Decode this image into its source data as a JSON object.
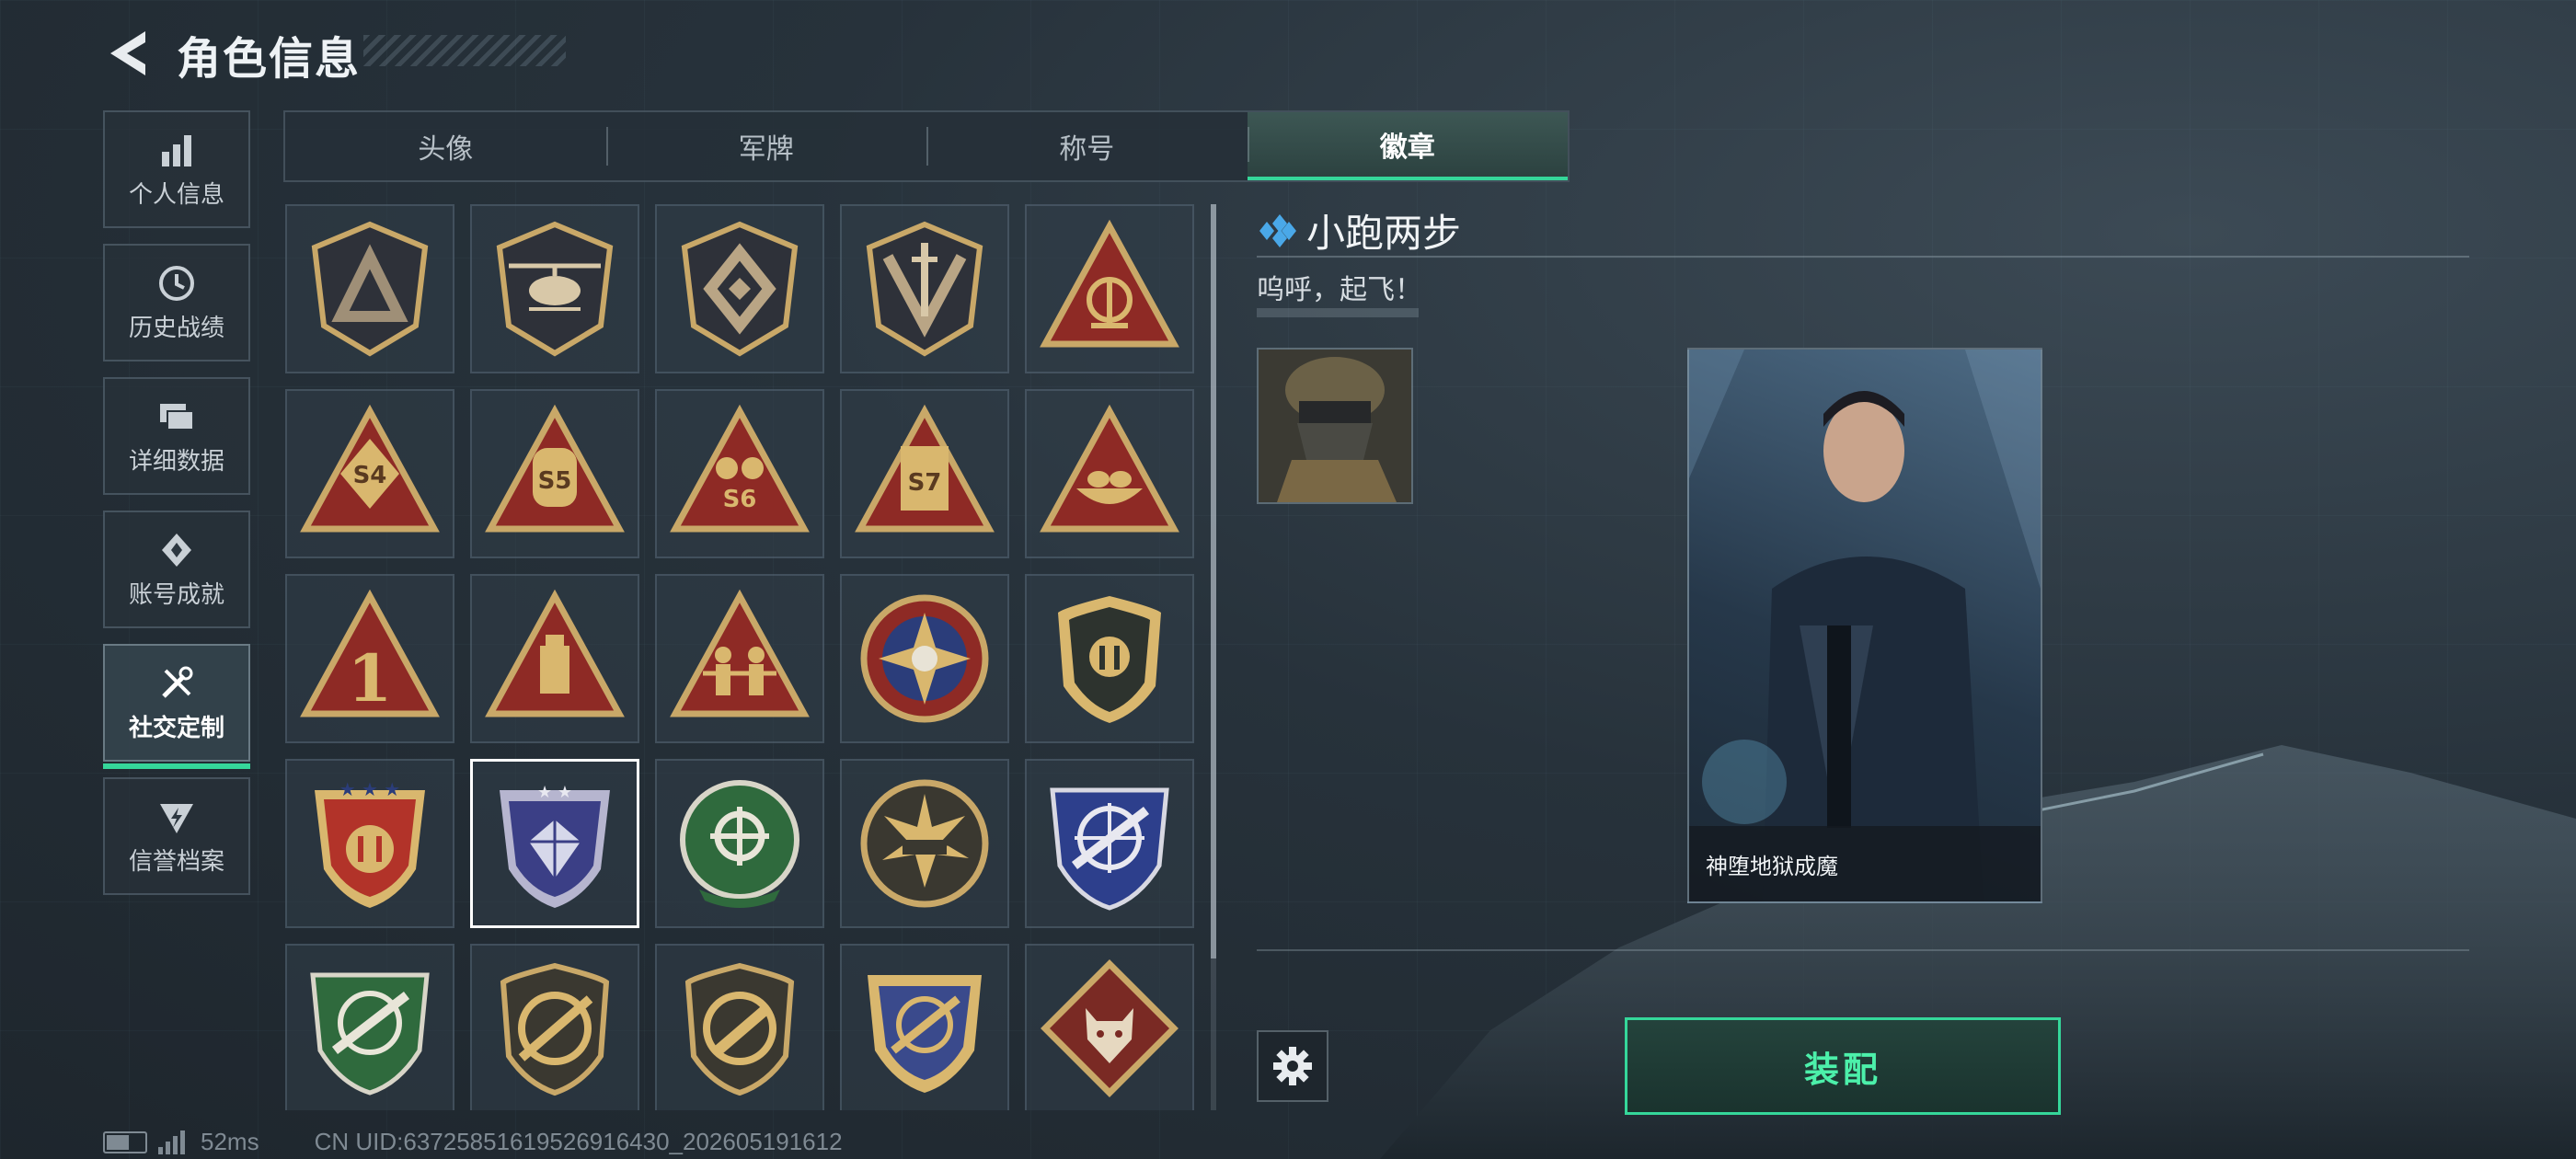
{
  "header": {
    "title": "角色信息"
  },
  "sidebar": {
    "items": [
      {
        "label": "个人信息",
        "icon": "bar-chart-icon",
        "active": false
      },
      {
        "label": "历史战绩",
        "icon": "clock-history-icon",
        "active": false
      },
      {
        "label": "详细数据",
        "icon": "folders-icon",
        "active": false
      },
      {
        "label": "账号成就",
        "icon": "achievement-icon",
        "active": false
      },
      {
        "label": "社交定制",
        "icon": "tools-icon",
        "active": true
      },
      {
        "label": "信誉档案",
        "icon": "reputation-shield-icon",
        "active": false
      }
    ]
  },
  "tabs": [
    {
      "label": "头像",
      "active": false
    },
    {
      "label": "军牌",
      "active": false
    },
    {
      "label": "称号",
      "active": false
    },
    {
      "label": "徽章",
      "active": true
    }
  ],
  "badges": [
    {
      "icon": "shield-triangle-badge",
      "selected": false
    },
    {
      "icon": "helicopter-badge",
      "selected": false
    },
    {
      "icon": "hex-shield-badge",
      "selected": false
    },
    {
      "icon": "sword-shield-badge",
      "selected": false
    },
    {
      "icon": "radar-triangle-badge",
      "selected": false
    },
    {
      "icon": "season-s4-badge",
      "selected": false
    },
    {
      "icon": "season-s5-badge",
      "selected": false
    },
    {
      "icon": "season-s6-badge",
      "selected": false
    },
    {
      "icon": "season-s7-badge",
      "selected": false
    },
    {
      "icon": "nest-triangle-badge",
      "selected": false
    },
    {
      "icon": "number-one-badge",
      "selected": false
    },
    {
      "icon": "usb-triangle-badge",
      "selected": false
    },
    {
      "icon": "soldiers-triangle-badge",
      "selected": false
    },
    {
      "icon": "star-skull-badge",
      "selected": false
    },
    {
      "icon": "dark-shield-badge",
      "selected": false
    },
    {
      "icon": "three-star-badge",
      "selected": false
    },
    {
      "icon": "diamond-shield-badge",
      "selected": true
    },
    {
      "icon": "green-crosshair-badge",
      "selected": false
    },
    {
      "icon": "tank-burst-badge",
      "selected": false
    },
    {
      "icon": "blue-rifle-badge",
      "selected": false
    },
    {
      "icon": "green-rifle-shield-badge",
      "selected": false
    },
    {
      "icon": "rifle-ring-badge",
      "selected": false
    },
    {
      "icon": "pistol-ring-badge",
      "selected": false
    },
    {
      "icon": "gold-rifle-shield-badge",
      "selected": false
    },
    {
      "icon": "wolf-diamond-badge",
      "selected": false
    }
  ],
  "detail": {
    "badge_name": "小跑两步",
    "description": "呜呼，起飞！",
    "card_name": "神堕地狱成魔",
    "equip_label": "装配"
  },
  "status": {
    "ping": "52ms",
    "uid": "CN UID:637258516195269164​30_202605191612"
  },
  "colors": {
    "accent_green": "#35d79a",
    "background": "#27323b",
    "badge_gold": "#c9a868",
    "badge_red": "#8e2a25"
  }
}
